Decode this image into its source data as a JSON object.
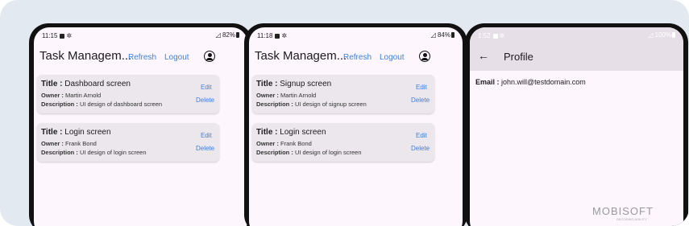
{
  "status": {
    "phone1": {
      "time": "11:15",
      "battery": "82%"
    },
    "phone2": {
      "time": "11:18",
      "battery": "84%"
    },
    "phone3": {
      "time": "1:52",
      "battery": "100%"
    }
  },
  "app": {
    "title": "Task Managem...",
    "refresh_label": "Refresh",
    "logout_label": "Logout"
  },
  "labels": {
    "title": "Title :",
    "owner": "Owner :",
    "description": "Description :",
    "edit": "Edit",
    "delete": "Delete"
  },
  "phone1_tasks": [
    {
      "title": "Dashboard screen",
      "owner": "Martin Arnold",
      "description": "UI design of dashboard screen"
    },
    {
      "title": "Login screen",
      "owner": "Frank Bond",
      "description": "UI design of login screen"
    }
  ],
  "phone2_tasks": [
    {
      "title": "Signup screen",
      "owner": "Martin Arnold",
      "description": "UI design of signup screen"
    },
    {
      "title": "Login screen",
      "owner": "Frank Bond",
      "description": "UI design of login screen"
    }
  ],
  "profile": {
    "title": "Profile",
    "email_label": "Email :",
    "email": "john.will@testdomain.com"
  },
  "brand": {
    "logo": "MOBISOFT",
    "tagline": "DECODING AGILITY"
  },
  "colors": {
    "accent": "#3f7fe3",
    "background": "#e3e9f1",
    "card": "#ebe7ec"
  }
}
